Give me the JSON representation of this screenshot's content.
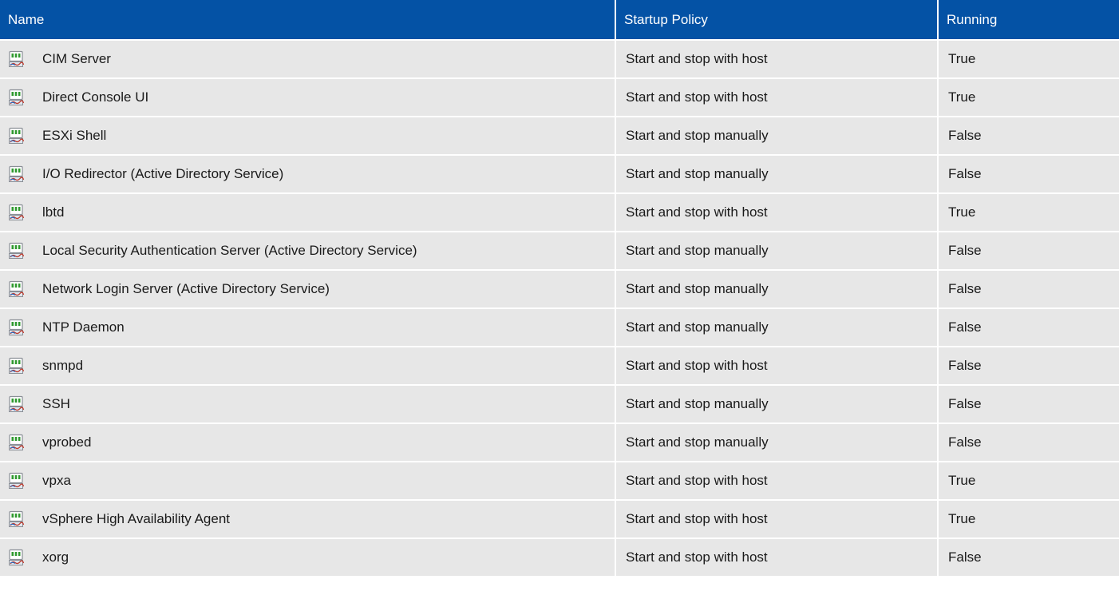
{
  "table": {
    "columns": [
      "Name",
      "Startup Policy",
      "Running"
    ],
    "rows": [
      {
        "name": "CIM Server",
        "policy": "Start and stop with host",
        "running": "True"
      },
      {
        "name": "Direct Console UI",
        "policy": "Start and stop with host",
        "running": "True"
      },
      {
        "name": "ESXi Shell",
        "policy": "Start and stop manually",
        "running": "False"
      },
      {
        "name": "I/O Redirector (Active Directory Service)",
        "policy": "Start and stop manually",
        "running": "False"
      },
      {
        "name": "lbtd",
        "policy": "Start and stop with host",
        "running": "True"
      },
      {
        "name": "Local Security Authentication Server (Active Directory Service)",
        "policy": "Start and stop manually",
        "running": "False"
      },
      {
        "name": "Network Login Server (Active Directory Service)",
        "policy": "Start and stop manually",
        "running": "False"
      },
      {
        "name": "NTP Daemon",
        "policy": "Start and stop manually",
        "running": "False"
      },
      {
        "name": "snmpd",
        "policy": "Start and stop with host",
        "running": "False"
      },
      {
        "name": "SSH",
        "policy": "Start and stop manually",
        "running": "False"
      },
      {
        "name": "vprobed",
        "policy": "Start and stop manually",
        "running": "False"
      },
      {
        "name": "vpxa",
        "policy": "Start and stop with host",
        "running": "True"
      },
      {
        "name": "vSphere High Availability Agent",
        "policy": "Start and stop with host",
        "running": "True"
      },
      {
        "name": "xorg",
        "policy": "Start and stop with host",
        "running": "False"
      }
    ]
  },
  "row_icon": "service-icon",
  "colors": {
    "header_bg": "#0452a5",
    "header_text": "#ffffff",
    "row_bg": "#e7e7e7"
  }
}
